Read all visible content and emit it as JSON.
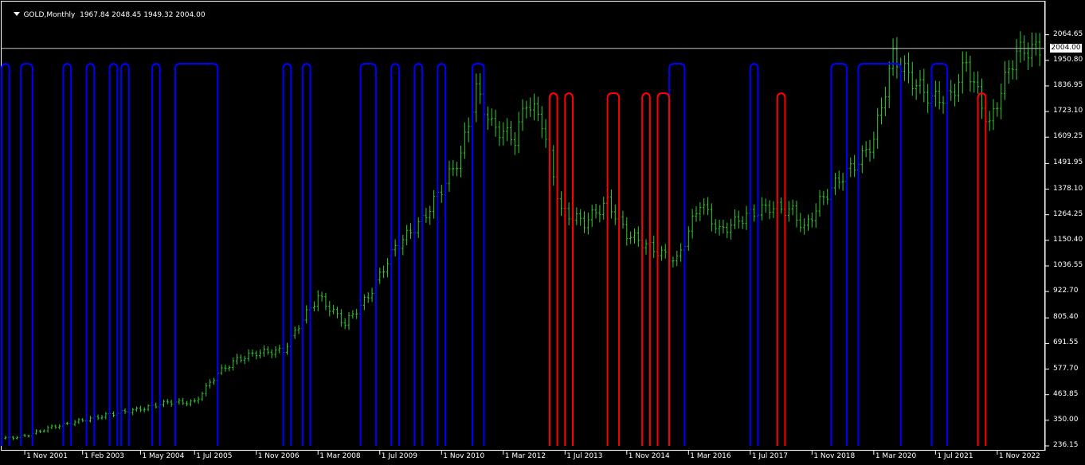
{
  "header": {
    "symbol": "GOLD,Monthly",
    "ohlc": "1967.84 2048.45 1949.32 2004.00"
  },
  "current_price_label": "2004.00",
  "colors": {
    "background": "#000000",
    "axis": "#ffffff",
    "candles": "#33cc33",
    "indicator_up": "#0000ff",
    "indicator_down": "#ff0000",
    "price_line": "#c0c0c0"
  },
  "chart_data": {
    "type": "line",
    "title": "",
    "xlabel": "",
    "ylabel": "",
    "ylim": [
      236.15,
      2120
    ],
    "grid": false,
    "y_ticks": [
      "2064.65",
      "1950.80",
      "1836.95",
      "1723.10",
      "1609.25",
      "1491.95",
      "1378.10",
      "1264.25",
      "1150.40",
      "1036.55",
      "922.70",
      "805.40",
      "691.55",
      "577.70",
      "463.85",
      "350.00",
      "236.15"
    ],
    "x_ticks": [
      "1 Nov 2001",
      "1 Feb 2003",
      "1 May 2004",
      "1 Jul 2005",
      "1 Nov 2006",
      "1 Mar 2008",
      "1 Jul 2009",
      "1 Nov 2010",
      "1 Mar 2012",
      "1 Jul 2013",
      "1 Nov 2014",
      "1 Mar 2016",
      "1 Jul 2017",
      "1 Nov 2018",
      "1 Mar 2020",
      "1 Jul 2021",
      "1 Nov 2022"
    ],
    "x_range": [
      "2001-05",
      "2023-11"
    ],
    "current_price": 2004.0,
    "series": [
      {
        "type": "close",
        "points": [
          [
            "2001-06",
            270
          ],
          [
            "2001-11",
            280
          ],
          [
            "2002-06",
            320
          ],
          [
            "2003-02",
            350
          ],
          [
            "2003-10",
            380
          ],
          [
            "2004-05",
            400
          ],
          [
            "2004-12",
            430
          ],
          [
            "2005-07",
            430
          ],
          [
            "2006-01",
            560
          ],
          [
            "2006-06",
            620
          ],
          [
            "2006-11",
            650
          ],
          [
            "2007-06",
            660
          ],
          [
            "2007-11",
            800
          ],
          [
            "2008-03",
            900
          ],
          [
            "2008-10",
            780
          ],
          [
            "2009-04",
            900
          ],
          [
            "2009-11",
            1120
          ],
          [
            "2010-06",
            1240
          ],
          [
            "2010-11",
            1380
          ],
          [
            "2011-04",
            1530
          ],
          [
            "2011-08",
            1820
          ],
          [
            "2011-12",
            1660
          ],
          [
            "2012-06",
            1600
          ],
          [
            "2012-09",
            1770
          ],
          [
            "2013-01",
            1680
          ],
          [
            "2013-06",
            1280
          ],
          [
            "2013-12",
            1230
          ],
          [
            "2014-06",
            1320
          ],
          [
            "2014-11",
            1180
          ],
          [
            "2015-07",
            1100
          ],
          [
            "2015-12",
            1060
          ],
          [
            "2016-06",
            1320
          ],
          [
            "2016-11",
            1190
          ],
          [
            "2017-06",
            1260
          ],
          [
            "2017-12",
            1300
          ],
          [
            "2018-06",
            1280
          ],
          [
            "2018-09",
            1200
          ],
          [
            "2019-01",
            1320
          ],
          [
            "2019-06",
            1420
          ],
          [
            "2019-12",
            1520
          ],
          [
            "2020-03",
            1600
          ],
          [
            "2020-08",
            1970
          ],
          [
            "2021-01",
            1860
          ],
          [
            "2021-06",
            1780
          ],
          [
            "2021-11",
            1790
          ],
          [
            "2022-03",
            1940
          ],
          [
            "2022-09",
            1660
          ],
          [
            "2022-12",
            1820
          ],
          [
            "2023-04",
            1990
          ],
          [
            "2023-10",
            2004
          ]
        ]
      },
      {
        "type": "indicator_up",
        "pulses": [
          [
            "2001-05",
            "2001-07"
          ],
          [
            "2001-10",
            "2002-01"
          ],
          [
            "2002-09",
            "2002-11"
          ],
          [
            "2003-03",
            "2003-05"
          ],
          [
            "2003-09",
            "2003-11"
          ],
          [
            "2003-12",
            "2004-02"
          ],
          [
            "2004-08",
            "2004-10"
          ],
          [
            "2005-02",
            "2006-01"
          ],
          [
            "2007-06",
            "2007-08"
          ],
          [
            "2007-11",
            "2008-01"
          ],
          [
            "2009-02",
            "2009-06"
          ],
          [
            "2009-10",
            "2009-12"
          ],
          [
            "2010-04",
            "2010-06"
          ],
          [
            "2010-10",
            "2010-12"
          ],
          [
            "2011-07",
            "2011-10"
          ],
          [
            "2015-10",
            "2016-02"
          ],
          [
            "2017-07",
            "2017-09"
          ],
          [
            "2019-04",
            "2019-08"
          ],
          [
            "2019-11",
            "2020-10"
          ],
          [
            "2021-06",
            "2021-10"
          ]
        ]
      },
      {
        "type": "indicator_down",
        "pulses": [
          [
            "2013-03",
            "2013-05"
          ],
          [
            "2013-07",
            "2013-09"
          ],
          [
            "2014-06",
            "2014-09"
          ],
          [
            "2015-03",
            "2015-05"
          ],
          [
            "2015-07",
            "2015-10"
          ],
          [
            "2018-02",
            "2018-04"
          ],
          [
            "2022-06",
            "2022-08"
          ]
        ]
      }
    ]
  }
}
